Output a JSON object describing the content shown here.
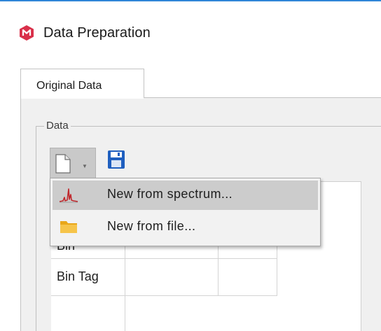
{
  "window": {
    "title": "Data Preparation",
    "app_icon": "app-logo-icon"
  },
  "tabs": [
    {
      "label": "Original Data",
      "selected": true
    }
  ],
  "group": {
    "title": "Data"
  },
  "toolbar": {
    "new_icon": "new-document-icon",
    "dropdown_icon": "chevron-down-icon",
    "save_icon": "save-disk-icon"
  },
  "context_menu": {
    "items": [
      {
        "label": "New from spectrum...",
        "icon": "spectrum-icon",
        "highlighted": true
      },
      {
        "label": "New from file...",
        "icon": "folder-icon",
        "highlighted": false
      }
    ]
  },
  "grid": {
    "row_headers": [
      "Bin",
      "Bin Tag"
    ]
  },
  "colors": {
    "accent": "#2f86d8",
    "app_icon": "#d9304a",
    "save_icon": "#1f5fbf",
    "folder_icon": "#f2b420",
    "spectrum_icon": "#c0282d"
  }
}
